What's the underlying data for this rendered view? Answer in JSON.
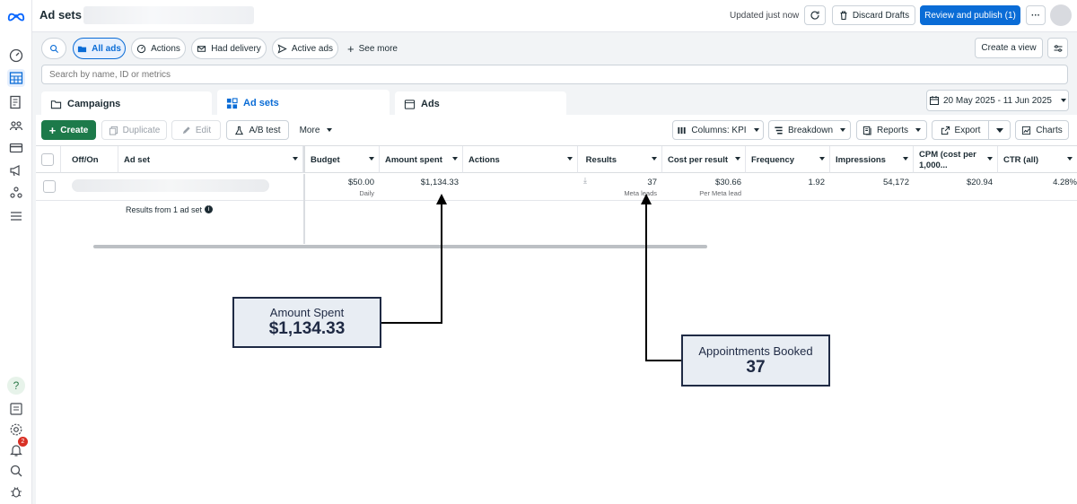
{
  "header": {
    "title": "Ad sets",
    "updated_text": "Updated just now",
    "discard_label": "Discard Drafts",
    "publish_label": "Review and publish (1)",
    "more_label": "···"
  },
  "filters": {
    "all_ads": "All ads",
    "actions": "Actions",
    "had_delivery": "Had delivery",
    "active_ads": "Active ads",
    "see_more": "See more",
    "create_view": "Create a view"
  },
  "search": {
    "placeholder": "Search by name, ID or metrics"
  },
  "tabs": {
    "campaigns": "Campaigns",
    "ad_sets": "Ad sets",
    "ads": "Ads"
  },
  "date_range": "20 May 2025 - 11 Jun 2025",
  "toolbar": {
    "create": "Create",
    "duplicate": "Duplicate",
    "edit": "Edit",
    "ab_test": "A/B test",
    "more": "More",
    "columns": "Columns: KPI",
    "breakdown": "Breakdown",
    "reports": "Reports",
    "export": "Export",
    "charts": "Charts"
  },
  "table": {
    "headers": {
      "off_on": "Off/On",
      "ad_set": "Ad set",
      "budget": "Budget",
      "amount_spent": "Amount spent",
      "actions": "Actions",
      "results": "Results",
      "cost_per_result": "Cost per result",
      "frequency": "Frequency",
      "impressions": "Impressions",
      "cpm_line1": "CPM (cost per",
      "cpm_line2": "1,000...",
      "ctr": "CTR (all)"
    },
    "row": {
      "budget": "$50.00",
      "budget_sub": "Daily",
      "amount_spent": "$1,134.33",
      "results": "37",
      "results_sub": "Meta leads",
      "cost_per_result": "$30.66",
      "cost_per_result_sub": "Per Meta lead",
      "frequency": "1.92",
      "impressions": "54,172",
      "cpm": "$20.94",
      "ctr": "4.28%"
    },
    "summary": "Results from 1 ad set"
  },
  "callouts": {
    "spent": {
      "label": "Amount Spent",
      "value": "$1,134.33"
    },
    "booked": {
      "label": "Appointments Booked",
      "value": "37"
    }
  },
  "notifications": {
    "count": "2"
  },
  "icons": [
    "meta-logo-icon",
    "dashboard-icon",
    "table-icon",
    "pages-icon",
    "audience-icon",
    "billing-icon",
    "megaphone-icon",
    "people-icon",
    "menu-icon",
    "help-icon",
    "news-icon",
    "settings-icon",
    "bell-icon",
    "search-icon",
    "bug-icon"
  ]
}
